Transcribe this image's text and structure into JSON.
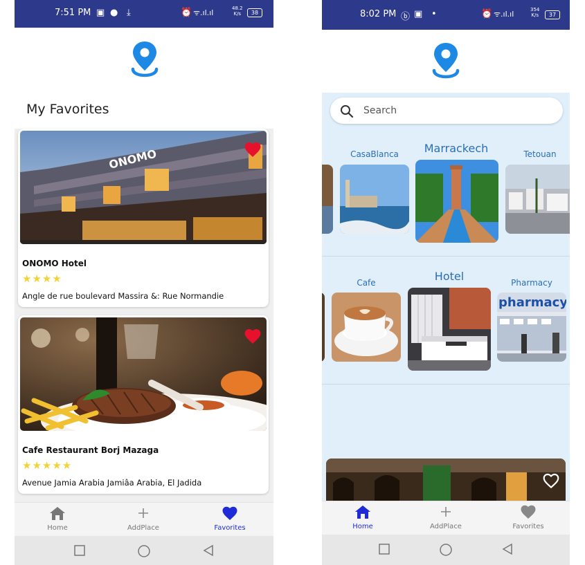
{
  "left": {
    "status": {
      "time": "7:51 PM",
      "net_speed_top": "48.2",
      "net_speed_unit": "K/s",
      "battery": "38"
    },
    "title": "My Favorites",
    "cards": [
      {
        "name": "ONOMO Hotel",
        "stars": "★★★★",
        "rating": 4,
        "address": "Angle de rue boulevard Massira &: Rue Normandie",
        "sign": "ONOMO"
      },
      {
        "name": "Cafe Restaurant Borj Mazaga",
        "stars": "★★★★★",
        "rating": 5,
        "address": "Avenue Jamia Arabia Jamiâa Arabia, El Jadida"
      }
    ],
    "tabs": [
      {
        "label": "Home",
        "icon": "home-icon"
      },
      {
        "label": "AddPlace",
        "icon": "plus-icon"
      },
      {
        "label": "Favorites",
        "icon": "heart-icon",
        "active": true
      }
    ]
  },
  "right": {
    "status": {
      "time": "8:02 PM",
      "net_speed_top": "354",
      "net_speed_unit": "K/s",
      "battery": "37"
    },
    "search": {
      "placeholder": "Search"
    },
    "cities": [
      {
        "label": "CasaBlanca"
      },
      {
        "label": "Marrackech",
        "selected": true
      },
      {
        "label": "Tetouan"
      }
    ],
    "categories": [
      {
        "label": "Cafe"
      },
      {
        "label": "Hotel",
        "selected": true
      },
      {
        "label": "Pharmacy",
        "sign": "pharmacy"
      }
    ],
    "tabs": [
      {
        "label": "Home",
        "icon": "home-icon",
        "active": true
      },
      {
        "label": "AddPlace",
        "icon": "plus-icon"
      },
      {
        "label": "Favorites",
        "icon": "heart-icon"
      }
    ]
  },
  "colors": {
    "status_bar": "#2d3a8c",
    "accent_blue": "#1f2bd6",
    "logo_blue": "#1e88e5",
    "heart_red": "#e8112d",
    "star_yellow": "#f3d233",
    "light_blue_bg": "#e0effa",
    "category_text": "#2a6fb8"
  }
}
